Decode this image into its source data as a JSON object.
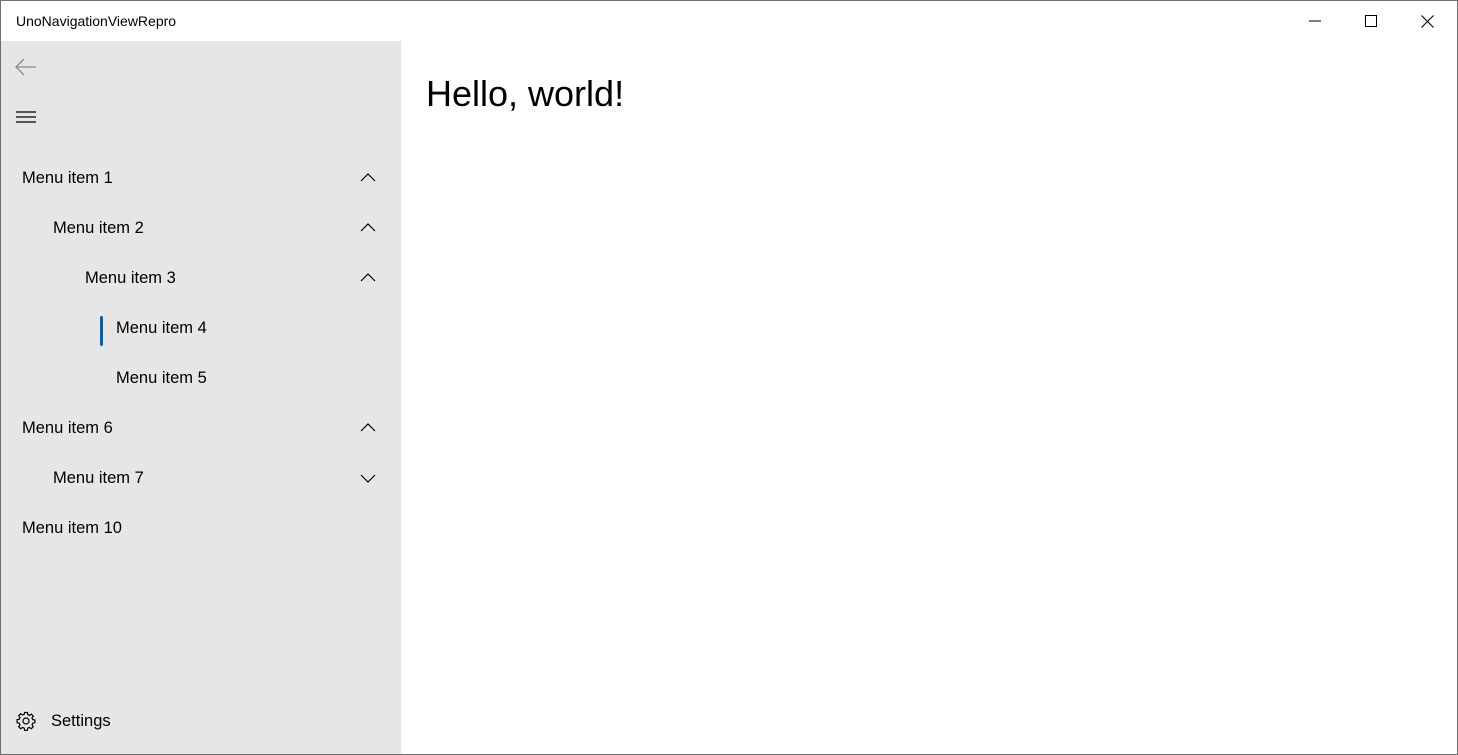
{
  "window": {
    "title": "UnoNavigationViewRepro"
  },
  "nav": {
    "menu_items": [
      {
        "label": "Menu item 1",
        "chevron": "up"
      },
      {
        "label": "Menu item 2",
        "chevron": "up"
      },
      {
        "label": "Menu item 3",
        "chevron": "up"
      },
      {
        "label": "Menu item 4",
        "selected": true
      },
      {
        "label": "Menu item 5"
      },
      {
        "label": "Menu item 6",
        "chevron": "up"
      },
      {
        "label": "Menu item 7",
        "chevron": "down"
      },
      {
        "label": "Menu item 10"
      }
    ],
    "settings_label": "Settings",
    "accent_color": "#0063b1",
    "pane_color": "#e6e6e6"
  },
  "content": {
    "heading": "Hello, world!"
  },
  "icons": {
    "back": "back-arrow-icon",
    "menu": "hamburger-icon",
    "settings": "gear-icon",
    "minimize": "minimize-icon",
    "maximize": "maximize-icon",
    "close": "close-icon"
  }
}
